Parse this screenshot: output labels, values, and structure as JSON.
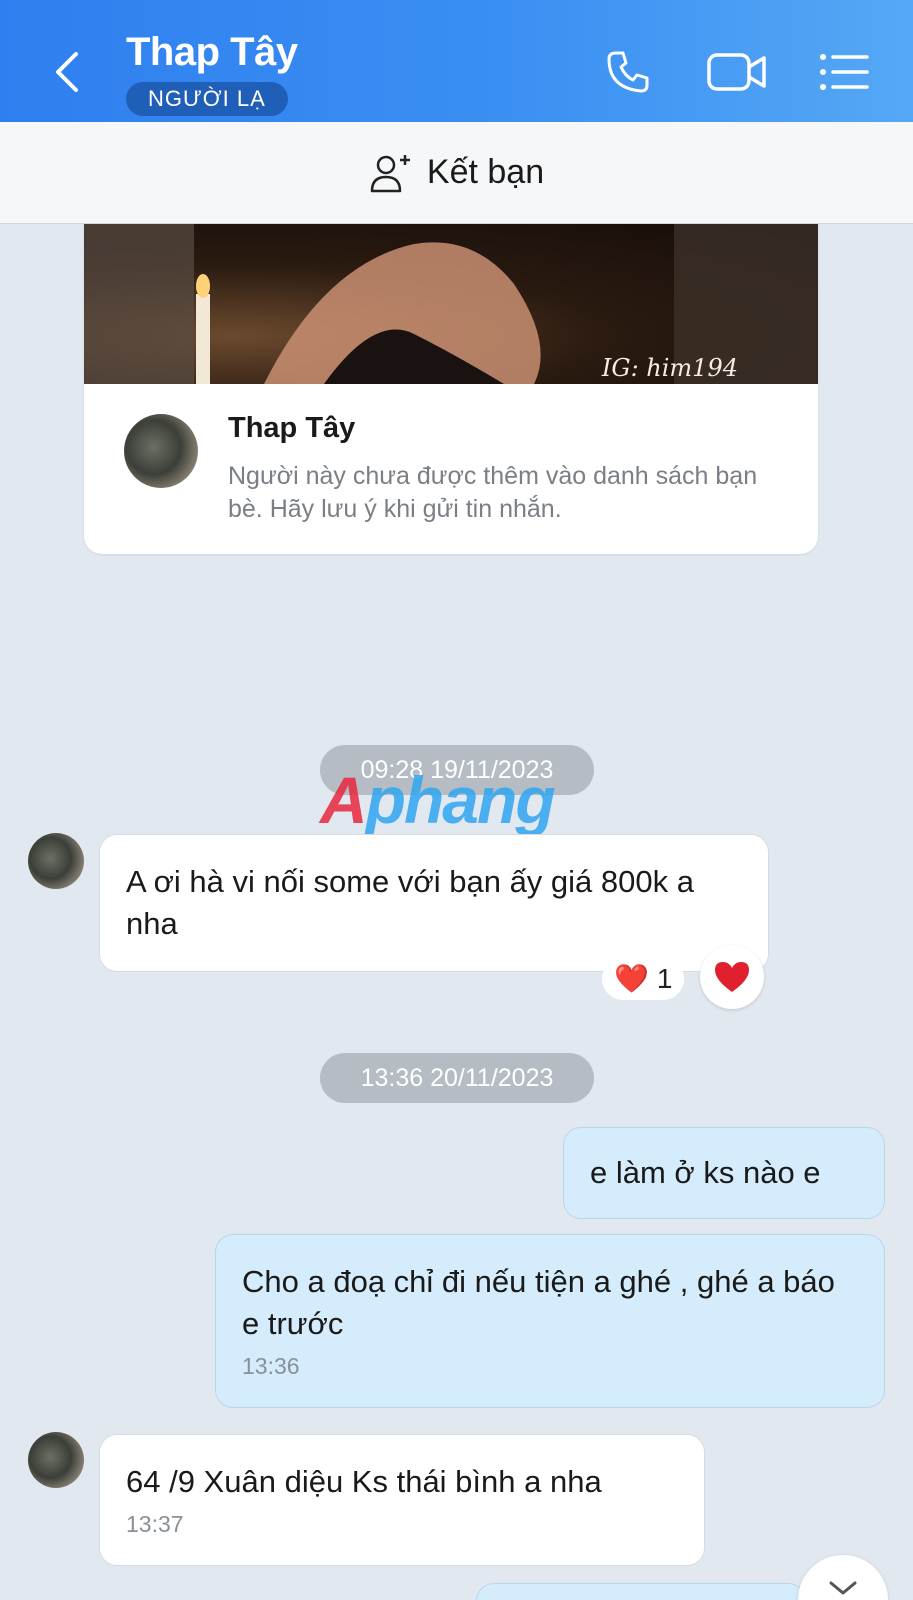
{
  "header": {
    "title": "Thap Tây",
    "badge": "NGƯỜI LẠ",
    "bg_color": "#2f7ff0"
  },
  "add_friend": {
    "label": "Kết bạn"
  },
  "profile_card": {
    "photo_watermark": "IG: him194",
    "name": "Thap Tây",
    "note": "Người này chưa được thêm vào danh sách bạn bè. Hãy lưu ý khi gửi tin nhắn."
  },
  "watermark": {
    "part1": "A",
    "part2": "phang"
  },
  "time_separators": [
    "09:28 19/11/2023",
    "13:36 20/11/2023"
  ],
  "messages": [
    {
      "side": "in",
      "text": "A ơi hà vi nối some với bạn ấy giá 800k a nha",
      "time": ""
    },
    {
      "side": "out",
      "text": "e làm ở ks nào e",
      "time": ""
    },
    {
      "side": "out",
      "text": "Cho a đoạ chỉ đi nếu tiện a ghé , ghé a báo e trước",
      "time": "13:36"
    },
    {
      "side": "in",
      "text": "64 /9 Xuân diệu Ks thái bình a nha",
      "time": "13:37"
    }
  ],
  "reaction": {
    "emoji": "❤️",
    "count": "1"
  }
}
